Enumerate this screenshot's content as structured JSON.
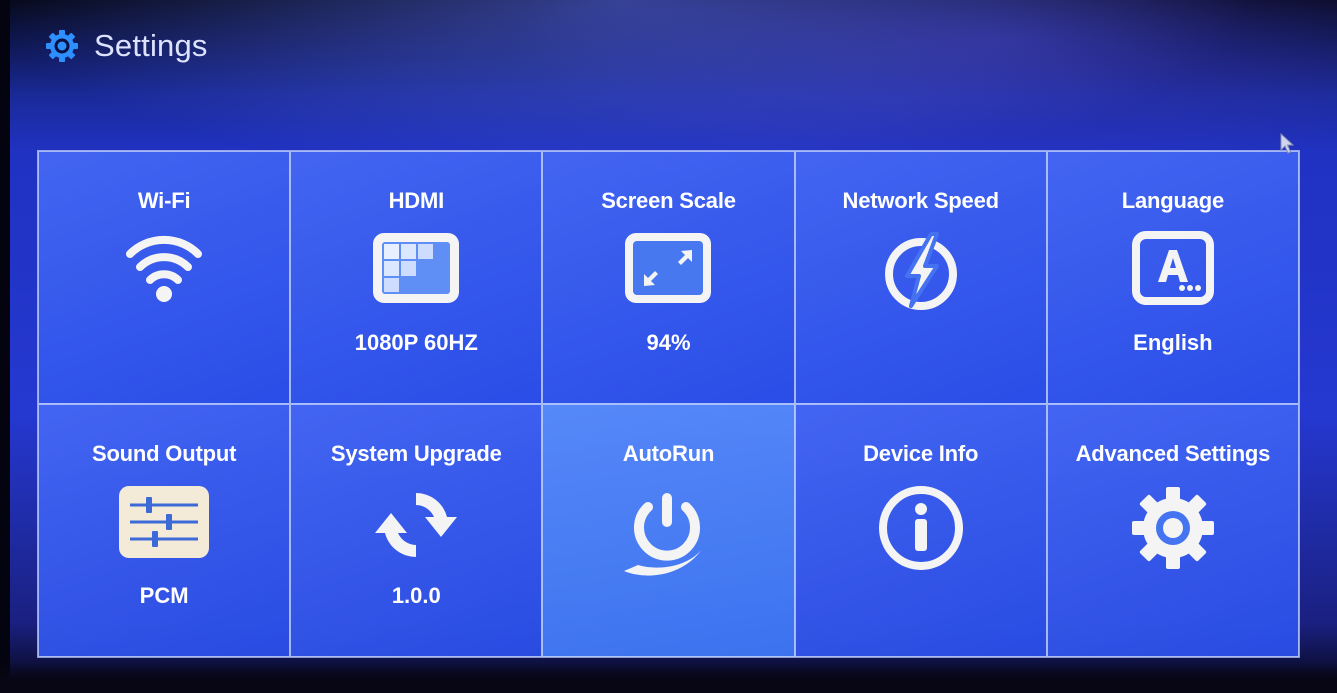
{
  "header": {
    "title": "Settings",
    "icon": "gear-icon"
  },
  "tiles": [
    {
      "label": "Wi-Fi",
      "icon": "wifi-icon",
      "value": ""
    },
    {
      "label": "HDMI",
      "icon": "display-resolution-icon",
      "value": "1080P 60HZ"
    },
    {
      "label": "Screen Scale",
      "icon": "screen-scale-icon",
      "value": "94%"
    },
    {
      "label": "Network Speed",
      "icon": "lightning-icon",
      "value": ""
    },
    {
      "label": "Language",
      "icon": "language-icon",
      "value": "English"
    },
    {
      "label": "Sound Output",
      "icon": "sliders-icon",
      "value": "PCM"
    },
    {
      "label": "System Upgrade",
      "icon": "refresh-icon",
      "value": "1.0.0"
    },
    {
      "label": "AutoRun",
      "icon": "power-icon",
      "value": ""
    },
    {
      "label": "Device Info",
      "icon": "info-icon",
      "value": ""
    },
    {
      "label": "Advanced Settings",
      "icon": "gear-icon",
      "value": ""
    }
  ],
  "colors": {
    "background": "#2538d0",
    "tile": "#3f6cf0",
    "tile_highlight": "#4d86f7",
    "text": "#ffffff",
    "icon_plate": "#f3f3f3"
  }
}
